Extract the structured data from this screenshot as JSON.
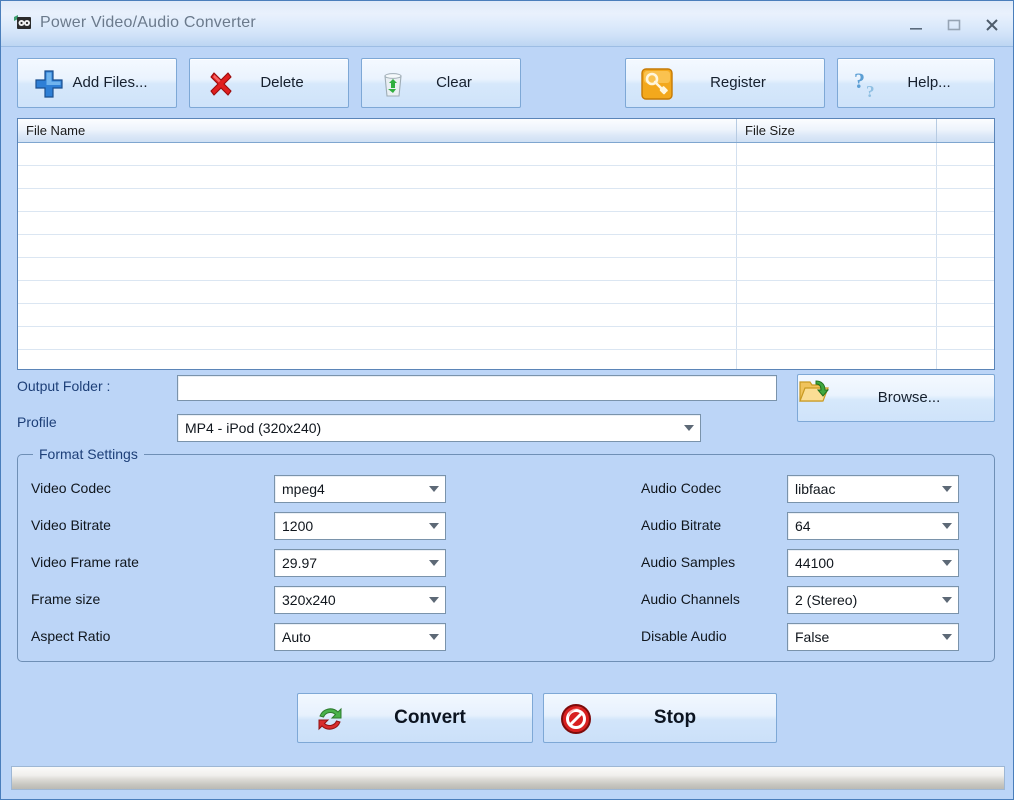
{
  "window": {
    "title": "Power Video/Audio Converter",
    "icon": "app-film-icon",
    "controls": {
      "minimize": "minimize-icon",
      "maximize": "maximize-icon",
      "close": "close-icon"
    }
  },
  "toolbar": {
    "buttons": [
      {
        "label": "Add Files...",
        "icon": "plus-icon"
      },
      {
        "label": "Delete",
        "icon": "red-x-icon"
      },
      {
        "label": "Clear",
        "icon": "recycle-bin-icon"
      },
      {
        "label": "Register",
        "icon": "key-icon"
      },
      {
        "label": "Help...",
        "icon": "question-mark-icon"
      }
    ]
  },
  "file_list": {
    "columns": [
      "File Name",
      "File Size",
      ""
    ],
    "rows": [],
    "empty_row_count": 10
  },
  "output": {
    "folder_label": "Output Folder :",
    "folder_value": "",
    "folder_placeholder": "",
    "browse_label": "Browse...",
    "browse_icon": "folder-open-icon",
    "profile_label": "Profile",
    "profile_value": "MP4 - iPod (320x240)"
  },
  "format_settings": {
    "title": "Format Settings",
    "video": [
      {
        "label": "Video Codec",
        "value": "mpeg4"
      },
      {
        "label": "Video Bitrate",
        "value": "1200"
      },
      {
        "label": "Video Frame rate",
        "value": "29.97"
      },
      {
        "label": "Frame size",
        "value": "320x240"
      },
      {
        "label": "Aspect Ratio",
        "value": "Auto"
      }
    ],
    "audio": [
      {
        "label": "Audio Codec",
        "value": "libfaac"
      },
      {
        "label": "Audio Bitrate",
        "value": "64"
      },
      {
        "label": "Audio Samples",
        "value": "44100"
      },
      {
        "label": "Audio Channels",
        "value": "2 (Stereo)"
      },
      {
        "label": "Disable Audio",
        "value": "False"
      }
    ]
  },
  "actions": {
    "convert_label": "Convert",
    "convert_icon": "refresh-cycle-icon",
    "stop_label": "Stop",
    "stop_icon": "stop-prohibition-icon"
  },
  "status": {
    "progress_percent": 0,
    "progress_text": ""
  },
  "colors": {
    "window_background": "#bcd5f7",
    "title_text": "#6b7a8c",
    "label_accent": "#1d3f78",
    "button_border": "#7ea8d6",
    "list_border": "#5b85b8"
  }
}
